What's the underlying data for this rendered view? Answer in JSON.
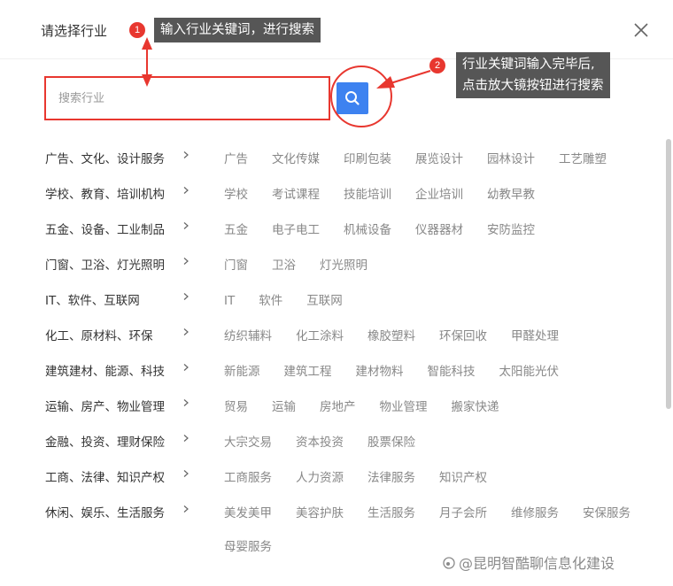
{
  "dialog": {
    "title": "请选择行业"
  },
  "search": {
    "placeholder": "搜索行业",
    "value": ""
  },
  "annotations": {
    "badge1": "1",
    "tip1": "输入行业关键词，进行搜索",
    "badge2": "2",
    "tip2_line1": "行业关键词输入完毕后,",
    "tip2_line2": "点击放大镜按钮进行搜索"
  },
  "industries": [
    {
      "category": "广告、文化、设计服务",
      "subs": [
        "广告",
        "文化传媒",
        "印刷包装",
        "展览设计",
        "园林设计",
        "工艺雕塑"
      ]
    },
    {
      "category": "学校、教育、培训机构",
      "subs": [
        "学校",
        "考试课程",
        "技能培训",
        "企业培训",
        "幼教早教"
      ]
    },
    {
      "category": "五金、设备、工业制品",
      "subs": [
        "五金",
        "电子电工",
        "机械设备",
        "仪器器材",
        "安防监控"
      ]
    },
    {
      "category": "门窗、卫浴、灯光照明",
      "subs": [
        "门窗",
        "卫浴",
        "灯光照明"
      ]
    },
    {
      "category": "IT、软件、互联网",
      "subs": [
        "IT",
        "软件",
        "互联网"
      ]
    },
    {
      "category": "化工、原材料、环保",
      "subs": [
        "纺织辅料",
        "化工涂料",
        "橡胶塑料",
        "环保回收",
        "甲醛处理"
      ]
    },
    {
      "category": "建筑建材、能源、科技",
      "subs": [
        "新能源",
        "建筑工程",
        "建材物料",
        "智能科技",
        "太阳能光伏"
      ]
    },
    {
      "category": "运输、房产、物业管理",
      "subs": [
        "贸易",
        "运输",
        "房地产",
        "物业管理",
        "搬家快递"
      ]
    },
    {
      "category": "金融、投资、理财保险",
      "subs": [
        "大宗交易",
        "资本投资",
        "股票保险"
      ]
    },
    {
      "category": "工商、法律、知识产权",
      "subs": [
        "工商服务",
        "人力资源",
        "法律服务",
        "知识产权"
      ]
    },
    {
      "category": "休闲、娱乐、生活服务",
      "subs": [
        "美发美甲",
        "美容护肤",
        "生活服务",
        "月子会所",
        "维修服务",
        "安保服务",
        "母婴服务"
      ]
    }
  ],
  "watermark": "@昆明智酷聊信息化建设",
  "colors": {
    "accent_red": "#e8372f",
    "search_blue": "#3d82f0",
    "tooltip_bg": "#565656"
  },
  "icons": [
    "close-icon",
    "search-icon",
    "chevron-right-icon",
    "weibo-logo-icon"
  ]
}
